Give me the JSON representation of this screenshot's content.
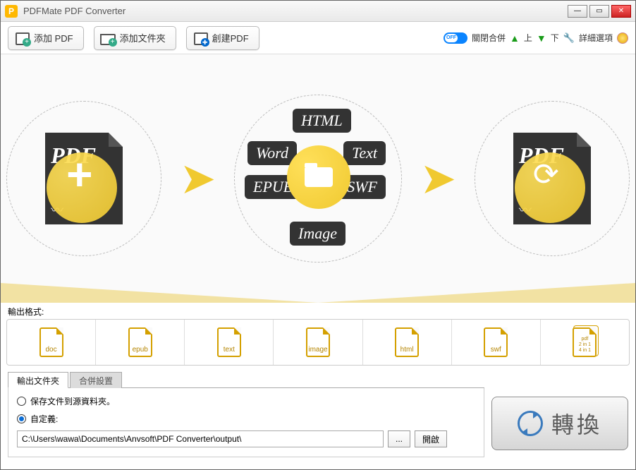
{
  "window": {
    "title": "PDFMate PDF Converter"
  },
  "toolbar": {
    "add_pdf": "添加 PDF",
    "add_folder": "添加文件夾",
    "build_pdf": "創建PDF",
    "toggle_text": "OFF",
    "merge_label": "關閉合併",
    "up": "上",
    "down": "下",
    "advanced": "詳細選項"
  },
  "stage": {
    "pdf_label": "PDF",
    "formats": {
      "html": "HTML",
      "word": "Word",
      "text": "Text",
      "epub": "EPUB",
      "swf": "SWF",
      "image": "Image"
    }
  },
  "output_formats": {
    "label": "輸出格式:",
    "items": [
      "doc",
      "epub",
      "text",
      "image",
      "html",
      "swf"
    ],
    "pdf_label": "pdf",
    "pdf_sub1": "2 in 1",
    "pdf_sub2": "4 in 1"
  },
  "tabs": {
    "output_folder": "輸出文件夾",
    "merge_settings": "合併設置"
  },
  "output": {
    "save_source": "保存文件到源資料夾。",
    "custom": "自定義:",
    "path": "C:\\Users\\wawa\\Documents\\Anvsoft\\PDF Converter\\output\\",
    "browse": "...",
    "open": "開啟"
  },
  "convert": {
    "label": "轉換"
  }
}
